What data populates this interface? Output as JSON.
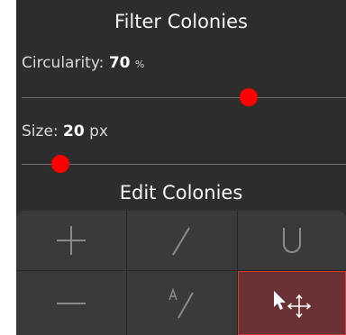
{
  "filter": {
    "title": "Filter Colonies",
    "circularity": {
      "label": "Circularity:",
      "value": "70",
      "unit": "%",
      "fraction": 0.7
    },
    "size": {
      "label": "Size:",
      "value": "20",
      "unit": "px",
      "fraction": 0.12
    }
  },
  "edit": {
    "title": "Edit Colonies",
    "tools": [
      {
        "name": "add-tool",
        "icon": "plus-icon",
        "active": false
      },
      {
        "name": "split-tool",
        "icon": "slash-icon",
        "active": false
      },
      {
        "name": "merge-tool",
        "icon": "union-icon",
        "active": false
      },
      {
        "name": "remove-tool",
        "icon": "minus-icon",
        "active": false
      },
      {
        "name": "label-tool",
        "icon": "label-slash-icon",
        "active": false
      },
      {
        "name": "move-tool",
        "icon": "cursor-move-icon",
        "active": true
      }
    ]
  },
  "colors": {
    "panel": "#2d2d2d",
    "thumb": "#ff0000",
    "active_tool": "#6a3234",
    "active_border": "#d03a3a"
  }
}
